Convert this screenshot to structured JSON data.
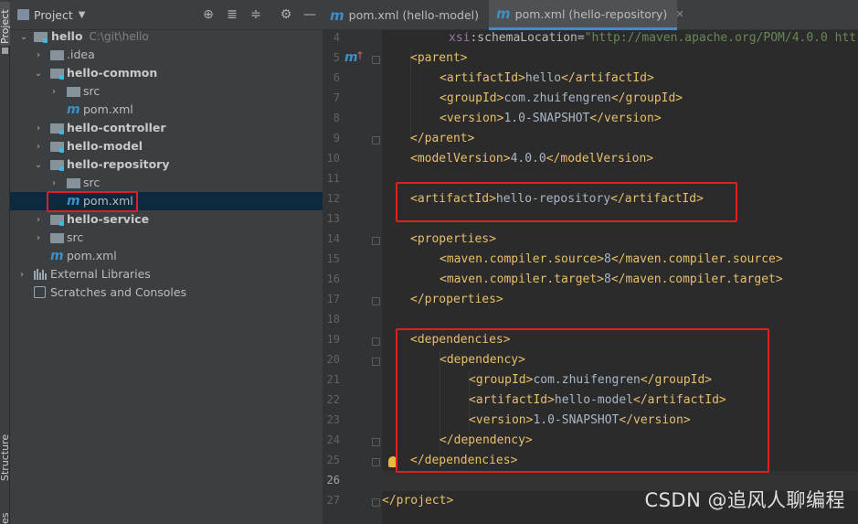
{
  "left_stripe": {
    "project_tab": "Project",
    "structure_tab": "Structure",
    "bottom_tab": "es"
  },
  "panel": {
    "title": "Project"
  },
  "tree": [
    {
      "label": "hello",
      "hint": "C:\\git\\hello",
      "bold": true
    },
    {
      "label": ".idea"
    },
    {
      "label": "hello-common",
      "bold": true
    },
    {
      "label": "src"
    },
    {
      "label": "pom.xml"
    },
    {
      "label": "hello-controller",
      "bold": true
    },
    {
      "label": "hello-model",
      "bold": true
    },
    {
      "label": "hello-repository",
      "bold": true
    },
    {
      "label": "src"
    },
    {
      "label": "pom.xml",
      "selected": true
    },
    {
      "label": "hello-service",
      "bold": true
    },
    {
      "label": "src"
    },
    {
      "label": "pom.xml"
    },
    {
      "label": "External Libraries"
    },
    {
      "label": "Scratches and Consoles"
    }
  ],
  "tabs": [
    {
      "label": "pom.xml (hello-model)",
      "active": false
    },
    {
      "label": "pom.xml (hello-repository)",
      "active": true
    }
  ],
  "line_numbers": [
    "4",
    "5",
    "6",
    "7",
    "8",
    "9",
    "10",
    "11",
    "12",
    "13",
    "14",
    "15",
    "16",
    "17",
    "18",
    "19",
    "20",
    "21",
    "22",
    "23",
    "24",
    "25",
    "26",
    "27"
  ],
  "code": {
    "l4": {
      "ns": "xsi",
      "attr": ":schemaLocation",
      "eq": "=",
      "str": "\"http://maven.apache.org/POM/4.0.0 htt"
    },
    "l5": "<parent>",
    "l6": {
      "open": "<artifactId>",
      "text": "hello",
      "close": "</artifactId>"
    },
    "l7": {
      "open": "<groupId>",
      "text": "com.zhuifengren",
      "close": "</groupId>"
    },
    "l8": {
      "open": "<version>",
      "text": "1.0-SNAPSHOT",
      "close": "</version>"
    },
    "l9": "</parent>",
    "l10": {
      "open": "<modelVersion>",
      "text": "4.0.0",
      "close": "</modelVersion>"
    },
    "l12": {
      "open": "<artifactId>",
      "text": "hello-repository",
      "close": "</artifactId>"
    },
    "l14": "<properties>",
    "l15": {
      "open": "<maven.compiler.source>",
      "text": "8",
      "close": "</maven.compiler.source>"
    },
    "l16": {
      "open": "<maven.compiler.target>",
      "text": "8",
      "close": "</maven.compiler.target>"
    },
    "l17": "</properties>",
    "l19": "<dependencies>",
    "l20": "<dependency>",
    "l21": {
      "open": "<groupId>",
      "text": "com.zhuifengren",
      "close": "</groupId>"
    },
    "l22": {
      "open": "<artifactId>",
      "text": "hello-model",
      "close": "</artifactId>"
    },
    "l23": {
      "open": "<version>",
      "text": "1.0-SNAPSHOT",
      "close": "</version>"
    },
    "l24": "</dependency>",
    "l25": "</dependencies>",
    "l27": "</project>"
  },
  "watermark": "CSDN @追风人聊编程",
  "colors": {
    "highlight_box": "#e02020",
    "tag": "#e8bf6a",
    "selection": "#0d293e"
  }
}
